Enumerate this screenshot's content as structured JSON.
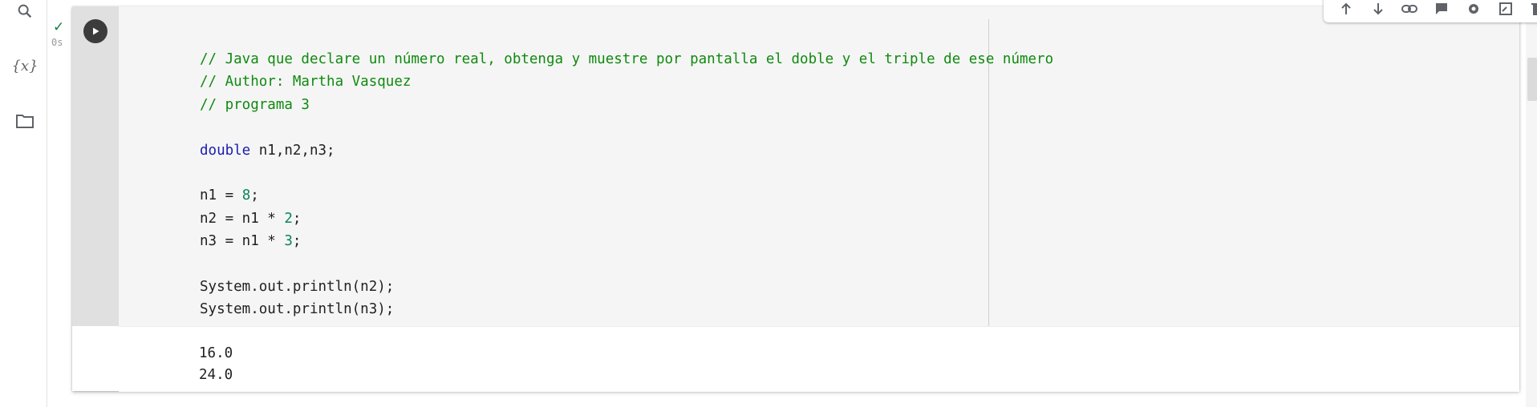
{
  "sidebar": {
    "icons": [
      {
        "name": "search-icon"
      },
      {
        "name": "variables-icon",
        "label": "{x}"
      },
      {
        "name": "folder-icon"
      }
    ]
  },
  "cell": {
    "status": {
      "time": "0s"
    },
    "code_lines": [
      [
        {
          "t": "cm",
          "v": "// Java que declare un número real, obtenga y muestre por pantalla el doble y el triple de ese número"
        }
      ],
      [
        {
          "t": "cm",
          "v": "// Author: Martha Vasquez"
        }
      ],
      [
        {
          "t": "cm",
          "v": "// programa 3"
        }
      ],
      [],
      [
        {
          "t": "kw",
          "v": "double"
        },
        {
          "t": "",
          "v": " n1,n2,n3;"
        }
      ],
      [],
      [
        {
          "t": "",
          "v": "n1 = "
        },
        {
          "t": "num",
          "v": "8"
        },
        {
          "t": "",
          "v": ";"
        }
      ],
      [
        {
          "t": "",
          "v": "n2 = n1 * "
        },
        {
          "t": "num",
          "v": "2"
        },
        {
          "t": "",
          "v": ";"
        }
      ],
      [
        {
          "t": "",
          "v": "n3 = n1 * "
        },
        {
          "t": "num",
          "v": "3"
        },
        {
          "t": "",
          "v": ";"
        }
      ],
      [],
      [
        {
          "t": "",
          "v": "System.out.println(n2);"
        }
      ],
      [
        {
          "t": "",
          "v": "System.out.println(n3);"
        }
      ]
    ],
    "output": "16.0\n24.0"
  },
  "toolbar": {
    "icons": [
      "move-up-icon",
      "move-down-icon",
      "link-icon",
      "comment-icon",
      "settings-icon",
      "mirror-cell-icon",
      "delete-icon",
      "more-icon"
    ]
  },
  "colors": {
    "comment": "#0f8a0f",
    "keyword": "#1b1bb0",
    "number": "#098658"
  }
}
